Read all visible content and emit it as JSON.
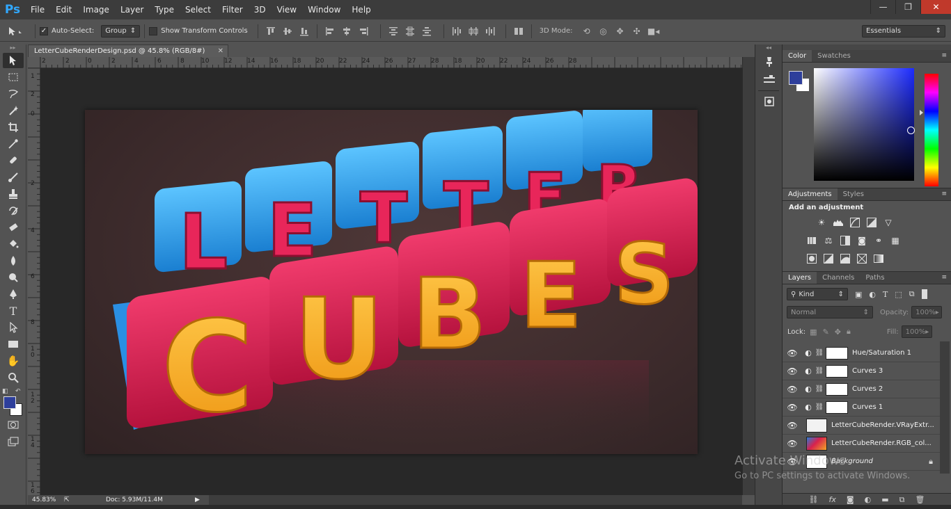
{
  "app": {
    "logo": "Ps"
  },
  "menu": [
    "File",
    "Edit",
    "Image",
    "Layer",
    "Type",
    "Select",
    "Filter",
    "3D",
    "View",
    "Window",
    "Help"
  ],
  "window_controls": {
    "minimize": "—",
    "restore": "❐",
    "close": "✕"
  },
  "options_bar": {
    "auto_select_label": "Auto-Select:",
    "auto_select_checked": "✓",
    "auto_select_value": "Group",
    "show_transform_label": "Show Transform Controls",
    "mode_3d_label": "3D Mode:",
    "workspace": "Essentials"
  },
  "document": {
    "tab_title": "LetterCubeRenderDesign.psd @ 45.8% (RGB/8#)",
    "close": "✕",
    "zoom": "45.83%",
    "doc_size": "Doc: 5.93M/11.4M"
  },
  "ruler_top_ticks": [
    "2",
    "2",
    "0",
    "2",
    "4",
    "6",
    "8",
    "10",
    "12",
    "14",
    "16",
    "18",
    "20",
    "22",
    "24",
    "26",
    "28"
  ],
  "ruler_top_ticks2": [
    "0",
    "2",
    "4",
    "6",
    "8",
    "10",
    "12",
    "14",
    "16",
    "18",
    "20",
    "22",
    "24",
    "26",
    "27",
    "28"
  ],
  "ruler_left_ticks": [
    "1",
    "2",
    "0",
    "2",
    "4",
    "6",
    "8",
    "1 0",
    "1 2",
    "1 4",
    "1 6"
  ],
  "artwork": {
    "top_word": [
      "L",
      "E",
      "T",
      "T",
      "E",
      "R"
    ],
    "bottom_word": [
      "C",
      "U",
      "B",
      "E",
      "S"
    ]
  },
  "color_panel": {
    "tabs": [
      "Color",
      "Swatches"
    ],
    "foreground": "#2e3f9b",
    "background": "#ffffff"
  },
  "adjustments_panel": {
    "tabs": [
      "Adjustments",
      "Styles"
    ],
    "title": "Add an adjustment"
  },
  "layers_panel": {
    "tabs": [
      "Layers",
      "Channels",
      "Paths"
    ],
    "filter_kind": "Kind",
    "blend_mode": "Normal",
    "opacity_label": "Opacity:",
    "opacity_value": "100%",
    "lock_label": "Lock:",
    "fill_label": "Fill:",
    "fill_value": "100%",
    "layers": [
      {
        "name": "Hue/Saturation 1",
        "type": "adjustment"
      },
      {
        "name": "Curves 3",
        "type": "adjustment"
      },
      {
        "name": "Curves 2",
        "type": "adjustment"
      },
      {
        "name": "Curves 1",
        "type": "adjustment"
      },
      {
        "name": "LetterCubeRender.VRayExtr...",
        "type": "pixel"
      },
      {
        "name": "LetterCubeRender.RGB_col...",
        "type": "pixel-rgb"
      },
      {
        "name": "Background",
        "type": "background"
      }
    ]
  },
  "watermark": {
    "title": "Activate Windows",
    "subtitle": "Go to PC settings to activate Windows."
  }
}
